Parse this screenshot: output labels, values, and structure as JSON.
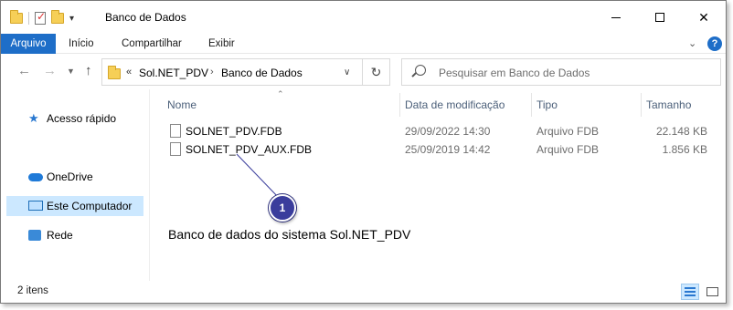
{
  "window": {
    "title": "Banco de Dados"
  },
  "ribbon": {
    "file_tab": "Arquivo",
    "tabs": [
      "Início",
      "Compartilhar",
      "Exibir"
    ],
    "help": "?"
  },
  "address": {
    "prefix": "«",
    "crumbs": [
      "Sol.NET_PDV",
      "Banco de Dados"
    ],
    "separator": "›"
  },
  "search": {
    "placeholder": "Pesquisar em Banco de Dados"
  },
  "navpane": {
    "items": [
      {
        "label": "Acesso rápido",
        "icon": "star-icon"
      },
      {
        "label": "OneDrive",
        "icon": "cloud-icon"
      },
      {
        "label": "Este Computador",
        "icon": "computer-icon",
        "selected": true
      },
      {
        "label": "Rede",
        "icon": "network-icon"
      }
    ]
  },
  "columns": {
    "name": "Nome",
    "date": "Data de modificação",
    "type": "Tipo",
    "size": "Tamanho"
  },
  "files": [
    {
      "name": "SOLNET_PDV.FDB",
      "date": "29/09/2022 14:30",
      "type": "Arquivo FDB",
      "size": "22.148 KB"
    },
    {
      "name": "SOLNET_PDV_AUX.FDB",
      "date": "25/09/2019 14:42",
      "type": "Arquivo FDB",
      "size": "1.856 KB"
    }
  ],
  "annotation": {
    "number": "1",
    "text": "Banco de dados do sistema Sol.NET_PDV"
  },
  "status": {
    "count": "2 itens"
  },
  "colors": {
    "accent": "#1e6ec8",
    "selection": "#cce8ff",
    "callout": "#3a3d9c"
  }
}
